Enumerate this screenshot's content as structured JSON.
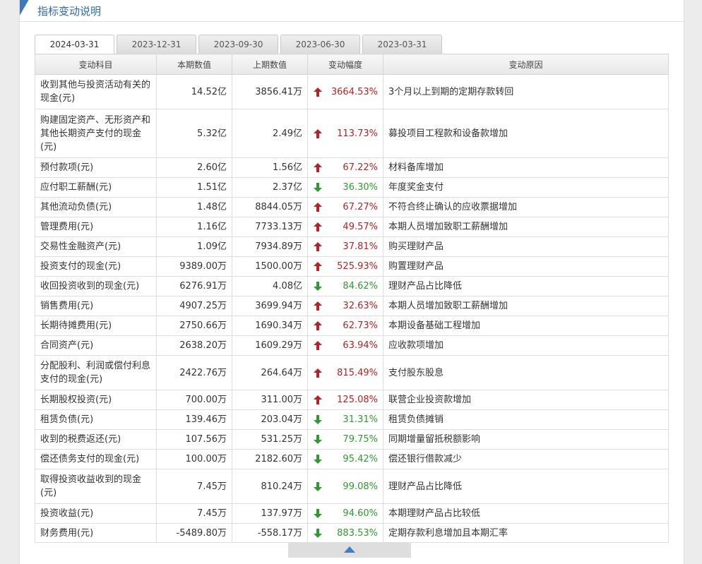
{
  "section_title": "指标变动说明",
  "tabs": [
    "2024-03-31",
    "2023-12-31",
    "2023-09-30",
    "2023-06-30",
    "2023-03-31"
  ],
  "active_tab": 0,
  "headers": [
    "变动科目",
    "本期数值",
    "上期数值",
    "变动幅度",
    "变动原因"
  ],
  "colors": {
    "up": "#b42323",
    "down": "#2f9a2f",
    "title": "#2f6ab0"
  },
  "rows": [
    {
      "name": "收到其他与投资活动有关的现金(元)",
      "cur": "14.52亿",
      "prev": "3856.41万",
      "dir": "up",
      "chg": "3664.53%",
      "reason": "3个月以上到期的定期存款转回"
    },
    {
      "name": "购建固定资产、无形资产和其他长期资产支付的现金(元)",
      "cur": "5.32亿",
      "prev": "2.49亿",
      "dir": "up",
      "chg": "113.73%",
      "reason": "募投项目工程款和设备款增加"
    },
    {
      "name": "预付款项(元)",
      "cur": "2.60亿",
      "prev": "1.56亿",
      "dir": "up",
      "chg": "67.22%",
      "reason": "材料备库增加"
    },
    {
      "name": "应付职工薪酬(元)",
      "cur": "1.51亿",
      "prev": "2.37亿",
      "dir": "down",
      "chg": "36.30%",
      "reason": "年度奖金支付"
    },
    {
      "name": "其他流动负债(元)",
      "cur": "1.48亿",
      "prev": "8844.05万",
      "dir": "up",
      "chg": "67.27%",
      "reason": "不符合终止确认的应收票据增加"
    },
    {
      "name": "管理费用(元)",
      "cur": "1.16亿",
      "prev": "7733.13万",
      "dir": "up",
      "chg": "49.57%",
      "reason": "本期人员增加致职工薪酬增加"
    },
    {
      "name": "交易性金融资产(元)",
      "cur": "1.09亿",
      "prev": "7934.89万",
      "dir": "up",
      "chg": "37.81%",
      "reason": "购买理财产品"
    },
    {
      "name": "投资支付的现金(元)",
      "cur": "9389.00万",
      "prev": "1500.00万",
      "dir": "up",
      "chg": "525.93%",
      "reason": "购置理财产品"
    },
    {
      "name": "收回投资收到的现金(元)",
      "cur": "6276.91万",
      "prev": "4.08亿",
      "dir": "down",
      "chg": "84.62%",
      "reason": "理财产品占比降低"
    },
    {
      "name": "销售费用(元)",
      "cur": "4907.25万",
      "prev": "3699.94万",
      "dir": "up",
      "chg": "32.63%",
      "reason": "本期人员增加致职工薪酬增加"
    },
    {
      "name": "长期待摊费用(元)",
      "cur": "2750.66万",
      "prev": "1690.34万",
      "dir": "up",
      "chg": "62.73%",
      "reason": "本期设备基础工程增加"
    },
    {
      "name": "合同资产(元)",
      "cur": "2638.20万",
      "prev": "1609.29万",
      "dir": "up",
      "chg": "63.94%",
      "reason": "应收款项增加"
    },
    {
      "name": "分配股利、利润或偿付利息支付的现金(元)",
      "cur": "2422.76万",
      "prev": "264.64万",
      "dir": "up",
      "chg": "815.49%",
      "reason": "支付股东股息"
    },
    {
      "name": "长期股权投资(元)",
      "cur": "700.00万",
      "prev": "311.00万",
      "dir": "up",
      "chg": "125.08%",
      "reason": "联营企业投资款增加"
    },
    {
      "name": "租赁负债(元)",
      "cur": "139.46万",
      "prev": "203.04万",
      "dir": "down",
      "chg": "31.31%",
      "reason": "租赁负债摊销"
    },
    {
      "name": "收到的税费返还(元)",
      "cur": "107.56万",
      "prev": "531.25万",
      "dir": "down",
      "chg": "79.75%",
      "reason": "同期增量留抵税额影响"
    },
    {
      "name": "偿还债务支付的现金(元)",
      "cur": "100.00万",
      "prev": "2182.60万",
      "dir": "down",
      "chg": "95.42%",
      "reason": "偿还银行借款减少"
    },
    {
      "name": "取得投资收益收到的现金(元)",
      "cur": "7.45万",
      "prev": "810.24万",
      "dir": "down",
      "chg": "99.08%",
      "reason": "理财产品占比降低"
    },
    {
      "name": "投资收益(元)",
      "cur": "7.45万",
      "prev": "137.97万",
      "dir": "down",
      "chg": "94.60%",
      "reason": "本期理财产品占比较低"
    },
    {
      "name": "财务费用(元)",
      "cur": "-5489.80万",
      "prev": "-558.17万",
      "dir": "down",
      "chg": "883.53%",
      "reason": "定期存款利息增加且本期汇率"
    }
  ]
}
